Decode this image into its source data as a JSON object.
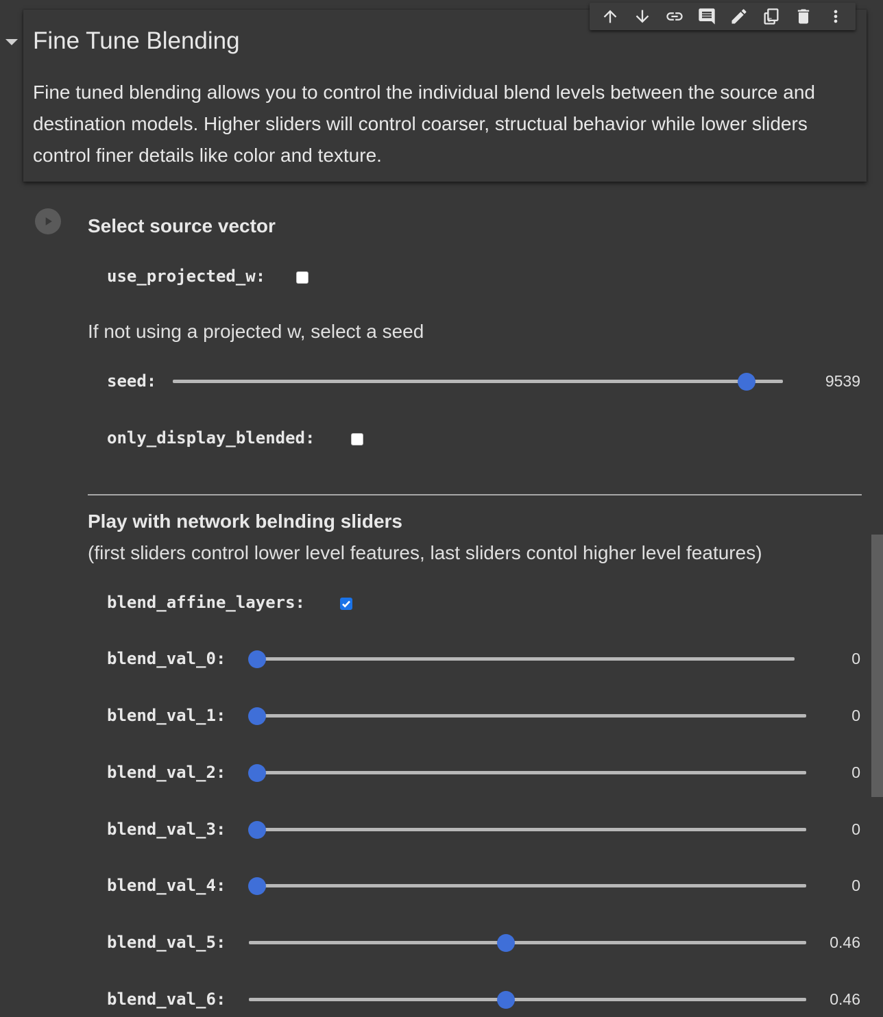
{
  "text_cell": {
    "title": "Fine Tune Blending",
    "description": "Fine tuned blending allows you to control the individual blend levels between the source and destination models. Higher sliders will control coarser, structual behavior while lower sliders control finer details like color and texture."
  },
  "toolbar": {
    "items": [
      {
        "icon": "arrow-up-icon"
      },
      {
        "icon": "arrow-down-icon"
      },
      {
        "icon": "link-icon"
      },
      {
        "icon": "comment-icon"
      },
      {
        "icon": "edit-icon"
      },
      {
        "icon": "mirror-cell-icon"
      },
      {
        "icon": "delete-icon"
      },
      {
        "icon": "more-vert-icon"
      }
    ]
  },
  "form": {
    "section1_title": "Select source vector",
    "use_projected_w": {
      "label": "use_projected_w:",
      "checked": false
    },
    "seed_hint": "If not using a projected w, select a seed",
    "seed": {
      "label": "seed:",
      "value": "9539",
      "fraction": 0.94
    },
    "only_display_blended": {
      "label": "only_display_blended:",
      "checked": false
    },
    "section2_title": "Play with network belnding sliders",
    "section2_subtitle": "(first sliders control lower level features, last sliders contol higher level features)",
    "blend_affine_layers": {
      "label": "blend_affine_layers:",
      "checked": true
    },
    "blend_sliders": [
      {
        "label": "blend_val_0:",
        "value": "0",
        "fraction": 0.0
      },
      {
        "label": "blend_val_1:",
        "value": "0",
        "fraction": 0.0
      },
      {
        "label": "blend_val_2:",
        "value": "0",
        "fraction": 0.0
      },
      {
        "label": "blend_val_3:",
        "value": "0",
        "fraction": 0.0
      },
      {
        "label": "blend_val_4:",
        "value": "0",
        "fraction": 0.0
      },
      {
        "label": "blend_val_5:",
        "value": "0.46",
        "fraction": 0.46
      },
      {
        "label": "blend_val_6:",
        "value": "0.46",
        "fraction": 0.46
      }
    ]
  },
  "colors": {
    "background": "#383838",
    "accent": "#3f6fd8",
    "checkbox_checked": "#1a73e8"
  }
}
